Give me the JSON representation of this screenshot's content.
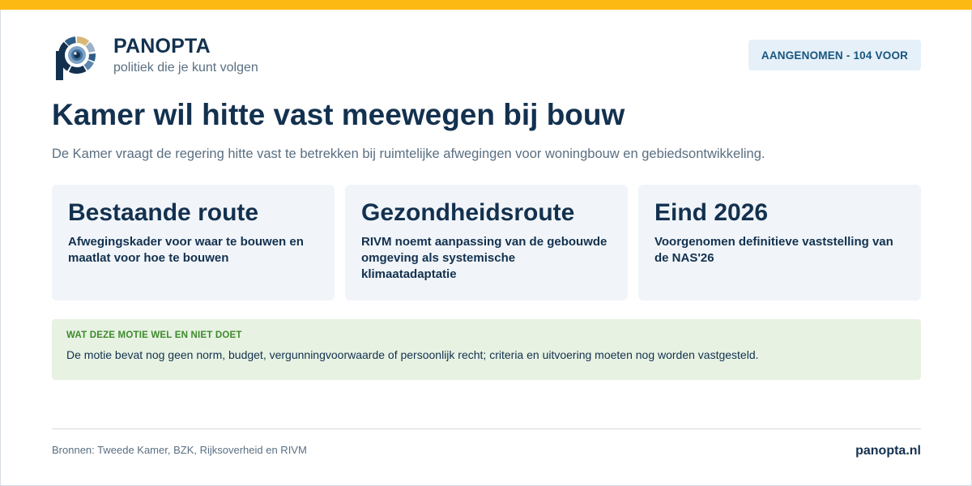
{
  "brand": {
    "name": "PANOPTA",
    "tagline": "politiek die je kunt volgen"
  },
  "status": {
    "label": "AANGENOMEN - 104 VOOR"
  },
  "headline": {
    "title": "Kamer wil hitte vast meewegen bij bouw",
    "subtitle": "De Kamer vraagt de regering hitte vast te betrekken bij ruimtelijke afwegingen voor woningbouw en gebiedsontwikkeling."
  },
  "cards": [
    {
      "title": "Bestaande route",
      "text": "Afwegingskader voor waar te bouwen en maatlat voor hoe te bouwen"
    },
    {
      "title": "Gezondheidsroute",
      "text": "RIVM noemt aanpassing van de gebouwde omgeving als systemische klimaatadaptatie"
    },
    {
      "title": "Eind 2026",
      "text": "Voorgenomen definitieve vaststelling van de NAS'26"
    }
  ],
  "note": {
    "heading": "WAT DEZE MOTIE WEL EN NIET DOET",
    "text": "De motie bevat nog geen norm, budget, vergunningvoorwaarde of persoonlijk recht; criteria en uitvoering moeten nog worden vastgesteld."
  },
  "footer": {
    "sources": "Bronnen: Tweede Kamer, BZK, Rijksoverheid en RIVM",
    "site": "panopta.nl"
  },
  "colors": {
    "accent_bar": "#fcb914",
    "primary_text": "#13314f",
    "muted_text": "#5a6f82",
    "badge_bg": "#e6f0f8",
    "badge_text": "#17557f",
    "card_bg": "#f1f5f9",
    "note_bg": "#e7f2e2",
    "note_heading": "#3d8a2c"
  },
  "icons": {
    "logo": "panopta-eye-logo-icon"
  }
}
